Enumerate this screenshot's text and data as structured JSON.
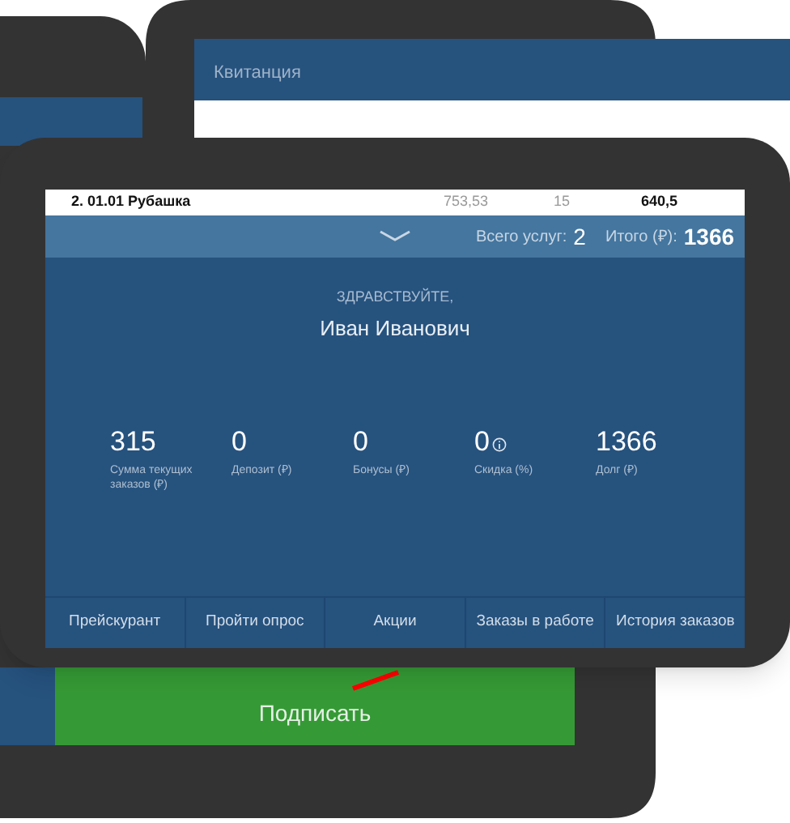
{
  "receipt": {
    "title": "Квитанция"
  },
  "sign_button": {
    "label": "Подписать"
  },
  "order_row": {
    "item": "2. 01.01 Рубашка",
    "price": "753,53",
    "discount": "15",
    "sum": "640,5"
  },
  "totals": {
    "services_label": "Всего услуг:",
    "services_value": "2",
    "total_label": "Итого (₽):",
    "total_value": "1366"
  },
  "greeting": {
    "hello": "ЗДРАВСТВУЙТЕ,",
    "name": "Иван Иванович"
  },
  "stats": [
    {
      "value": "315",
      "label": "Сумма текущих заказов (₽)",
      "info": false
    },
    {
      "value": "0",
      "label": "Депозит (₽)",
      "info": false
    },
    {
      "value": "0",
      "label": "Бонусы (₽)",
      "info": false
    },
    {
      "value": "0",
      "label": "Скидка (%)",
      "info": true
    },
    {
      "value": "1366",
      "label": "Долг (₽)",
      "info": false
    }
  ],
  "nav": [
    "Прейскурант",
    "Пройти опрос",
    "Акции",
    "Заказы в работе",
    "История заказов"
  ]
}
